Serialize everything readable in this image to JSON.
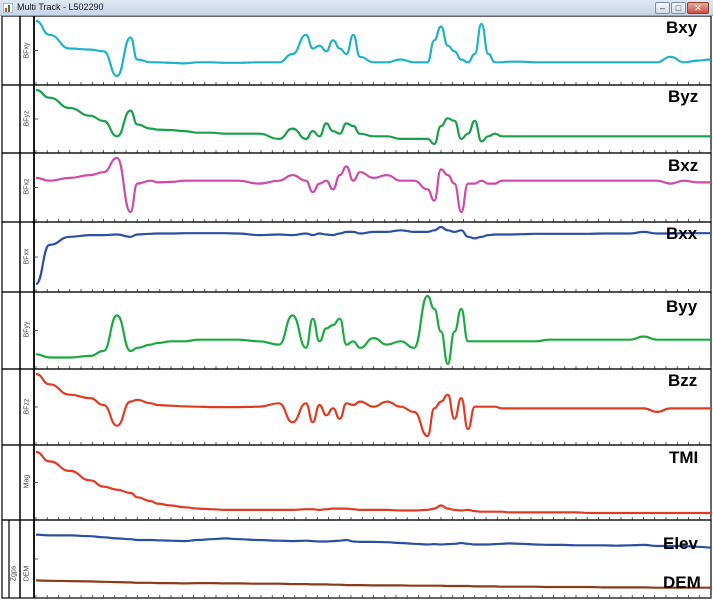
{
  "window": {
    "title": "Multi Track - L502290"
  },
  "window_controls": {
    "minimize": "–",
    "maximize": "□",
    "close": "✕"
  },
  "colors": {
    "Bxy": "#1fb2c7",
    "Byz": "#18a04a",
    "Bxz": "#cc4aa8",
    "Bxx": "#2c4ea3",
    "Byy": "#1aaa40",
    "Bzz": "#df3b22",
    "TMI": "#df3b22",
    "Elev": "#2c4ea3",
    "DEM": "#8b3a1a"
  },
  "tracks": [
    {
      "name": "Bxy",
      "axis_label": "BFxy"
    },
    {
      "name": "Byz",
      "axis_label": "BFyz"
    },
    {
      "name": "Bxz",
      "axis_label": "BFxz"
    },
    {
      "name": "Bxx",
      "axis_label": "BFxx"
    },
    {
      "name": "Byy",
      "axis_label": "BFyy"
    },
    {
      "name": "Bzz",
      "axis_label": "BFzz"
    },
    {
      "name": "TMI",
      "axis_label": "Mag"
    },
    {
      "name": "Elev",
      "axis_label": "Zgps"
    },
    {
      "name": "DEM",
      "axis_label": "DEM"
    }
  ],
  "chart_data": {
    "type": "line",
    "x": [
      0,
      2,
      5,
      8,
      10,
      12,
      14,
      15,
      17,
      18,
      20,
      22,
      24,
      26,
      28,
      30,
      33,
      36,
      38,
      40,
      41,
      42,
      43,
      44,
      45,
      46,
      47,
      48,
      50,
      52,
      54,
      56,
      58,
      59,
      60,
      61,
      62,
      63,
      64,
      65,
      66,
      67,
      68,
      69,
      70,
      72,
      74,
      76,
      78,
      80,
      82,
      84,
      86,
      88,
      90,
      92,
      94,
      96,
      98,
      100
    ],
    "series": [
      {
        "name": "Bxy",
        "values": [
          0.8,
          0.55,
          0.3,
          0.28,
          0.25,
          -0.2,
          0.5,
          0.1,
          0.05,
          0.05,
          0.04,
          0.03,
          0.05,
          0.05,
          0.04,
          0.04,
          0.05,
          0.05,
          0.2,
          0.55,
          0.3,
          0.35,
          0.25,
          0.45,
          0.3,
          0.2,
          0.55,
          0.15,
          0.05,
          0.05,
          0.1,
          0.05,
          0.05,
          0.45,
          0.7,
          0.35,
          0.25,
          0.1,
          0.05,
          0.2,
          0.75,
          0.2,
          0.05,
          0.05,
          0.06,
          0.06,
          0.05,
          0.05,
          0.05,
          0.05,
          0.05,
          0.05,
          0.05,
          0.05,
          0.05,
          0.05,
          0.15,
          0.05,
          0.08,
          0.1
        ]
      },
      {
        "name": "Byz",
        "values": [
          0.95,
          0.8,
          0.6,
          0.45,
          0.35,
          0.05,
          0.55,
          0.28,
          0.2,
          0.18,
          0.17,
          0.15,
          0.12,
          0.12,
          0.1,
          0.1,
          0.1,
          0.0,
          0.2,
          0.0,
          0.15,
          0.05,
          0.3,
          0.15,
          0.1,
          0.3,
          0.25,
          0.1,
          0.05,
          0.05,
          0.0,
          0.0,
          0.0,
          -0.1,
          0.25,
          0.4,
          0.35,
          0.0,
          0.1,
          0.35,
          -0.05,
          0.05,
          0.1,
          0.05,
          0.05,
          0.05,
          0.05,
          0.05,
          0.05,
          0.05,
          0.05,
          0.05,
          0.05,
          0.05,
          0.05,
          0.05,
          0.05,
          0.05,
          0.05,
          0.05
        ]
      },
      {
        "name": "Bxz",
        "values": [
          0.5,
          0.45,
          0.5,
          0.55,
          0.6,
          0.85,
          -0.1,
          0.4,
          0.45,
          0.42,
          0.43,
          0.45,
          0.45,
          0.45,
          0.45,
          0.45,
          0.4,
          0.45,
          0.55,
          0.45,
          0.25,
          0.4,
          0.45,
          0.3,
          0.55,
          0.7,
          0.45,
          0.6,
          0.5,
          0.55,
          0.45,
          0.45,
          0.3,
          0.1,
          0.65,
          0.55,
          0.4,
          -0.1,
          0.4,
          0.4,
          0.45,
          0.4,
          0.4,
          0.45,
          0.45,
          0.45,
          0.45,
          0.45,
          0.45,
          0.45,
          0.45,
          0.45,
          0.45,
          0.45,
          0.45,
          0.45,
          0.4,
          0.45,
          0.42,
          0.42
        ]
      },
      {
        "name": "Bxx",
        "values": [
          -0.9,
          0.3,
          0.55,
          0.6,
          0.6,
          0.62,
          0.55,
          0.62,
          0.64,
          0.65,
          0.65,
          0.66,
          0.66,
          0.66,
          0.66,
          0.65,
          0.6,
          0.62,
          0.6,
          0.65,
          0.6,
          0.65,
          0.62,
          0.6,
          0.65,
          0.7,
          0.7,
          0.65,
          0.7,
          0.7,
          0.75,
          0.7,
          0.7,
          0.75,
          0.85,
          0.75,
          0.7,
          0.75,
          0.55,
          0.5,
          0.55,
          0.6,
          0.62,
          0.62,
          0.62,
          0.63,
          0.64,
          0.64,
          0.64,
          0.64,
          0.64,
          0.65,
          0.65,
          0.65,
          0.7,
          0.65,
          0.65,
          0.66,
          0.66,
          0.66
        ]
      },
      {
        "name": "Byy",
        "values": [
          -0.5,
          -0.6,
          -0.6,
          -0.55,
          -0.4,
          0.7,
          -0.4,
          -0.3,
          -0.2,
          -0.15,
          -0.1,
          -0.1,
          -0.05,
          -0.05,
          -0.05,
          -0.05,
          -0.1,
          -0.2,
          0.7,
          -0.3,
          0.6,
          -0.1,
          0.3,
          0.4,
          0.6,
          -0.2,
          -0.1,
          -0.3,
          0.0,
          -0.2,
          -0.1,
          -0.3,
          1.3,
          0.9,
          0.2,
          -0.8,
          0.2,
          0.9,
          -0.1,
          -0.1,
          -0.1,
          -0.1,
          -0.1,
          -0.1,
          -0.1,
          -0.1,
          -0.1,
          -0.05,
          -0.05,
          -0.05,
          -0.05,
          -0.05,
          -0.05,
          -0.05,
          0.05,
          -0.05,
          -0.05,
          -0.05,
          -0.05,
          -0.05
        ]
      },
      {
        "name": "Bzz",
        "values": [
          1.0,
          0.7,
          0.4,
          0.3,
          0.1,
          -0.5,
          0.2,
          0.25,
          0.15,
          0.1,
          0.08,
          0.06,
          0.05,
          0.04,
          0.04,
          0.04,
          0.05,
          0.15,
          -0.4,
          0.15,
          -0.4,
          0.1,
          -0.2,
          0.0,
          -0.3,
          0.15,
          0.1,
          0.2,
          0.05,
          0.2,
          0.05,
          -0.1,
          -0.8,
          0.0,
          0.2,
          0.4,
          -0.3,
          0.3,
          -0.6,
          0.05,
          0.05,
          0.05,
          0.05,
          0.0,
          0.0,
          0.0,
          0.0,
          0.0,
          0.0,
          0.0,
          0.0,
          0.0,
          0.0,
          0.0,
          0.0,
          -0.1,
          0.0,
          0.0,
          0.0,
          0.0
        ]
      },
      {
        "name": "TMI",
        "values": [
          1.0,
          0.85,
          0.7,
          0.55,
          0.45,
          0.4,
          0.35,
          0.28,
          0.22,
          0.18,
          0.15,
          0.12,
          0.1,
          0.09,
          0.08,
          0.08,
          0.08,
          0.08,
          0.08,
          0.09,
          0.09,
          0.08,
          0.09,
          0.1,
          0.1,
          0.1,
          0.09,
          0.08,
          0.08,
          0.08,
          0.07,
          0.07,
          0.08,
          0.1,
          0.15,
          0.1,
          0.08,
          0.07,
          0.08,
          0.06,
          0.05,
          0.05,
          0.05,
          0.05,
          0.04,
          0.04,
          0.04,
          0.04,
          0.04,
          0.04,
          0.03,
          0.03,
          0.03,
          0.03,
          0.03,
          0.03,
          0.03,
          0.03,
          0.03,
          0.03
        ]
      },
      {
        "name": "Elev",
        "values": [
          0.72,
          0.7,
          0.7,
          0.68,
          0.65,
          0.62,
          0.6,
          0.58,
          0.58,
          0.57,
          0.56,
          0.55,
          0.58,
          0.6,
          0.62,
          0.6,
          0.58,
          0.56,
          0.55,
          0.56,
          0.55,
          0.54,
          0.54,
          0.55,
          0.56,
          0.58,
          0.54,
          0.53,
          0.53,
          0.52,
          0.5,
          0.48,
          0.46,
          0.47,
          0.46,
          0.47,
          0.48,
          0.5,
          0.48,
          0.46,
          0.46,
          0.46,
          0.47,
          0.48,
          0.49,
          0.48,
          0.46,
          0.45,
          0.45,
          0.44,
          0.44,
          0.44,
          0.43,
          0.44,
          0.45,
          0.42,
          0.42,
          0.42,
          0.4,
          0.38
        ]
      },
      {
        "name": "DEM",
        "values": [
          0.32,
          0.31,
          0.3,
          0.29,
          0.28,
          0.27,
          0.26,
          0.25,
          0.25,
          0.24,
          0.24,
          0.23,
          0.24,
          0.24,
          0.23,
          0.23,
          0.22,
          0.22,
          0.21,
          0.21,
          0.2,
          0.2,
          0.2,
          0.19,
          0.19,
          0.18,
          0.18,
          0.18,
          0.17,
          0.17,
          0.17,
          0.16,
          0.16,
          0.16,
          0.16,
          0.15,
          0.15,
          0.15,
          0.15,
          0.14,
          0.14,
          0.14,
          0.14,
          0.13,
          0.13,
          0.13,
          0.13,
          0.12,
          0.12,
          0.12,
          0.12,
          0.11,
          0.11,
          0.11,
          0.11,
          0.1,
          0.1,
          0.1,
          0.1,
          0.1
        ]
      }
    ],
    "grid": false,
    "legend": "none"
  }
}
